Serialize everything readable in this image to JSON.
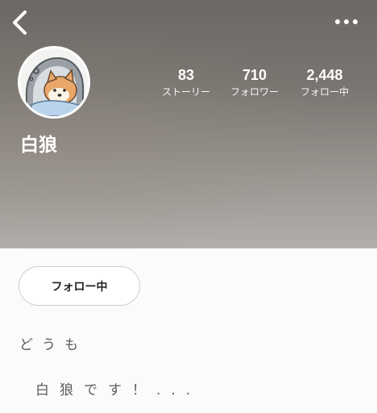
{
  "nav": {
    "back_icon": "chevron-left-icon",
    "more_icon": "more-horizontal-icon"
  },
  "profile": {
    "name": "白狼",
    "avatar_icon": "shiba-dog-avatar",
    "stats": [
      {
        "value": "83",
        "label": "ストーリー"
      },
      {
        "value": "710",
        "label": "フォロワー"
      },
      {
        "value": "2,448",
        "label": "フォロー中"
      }
    ],
    "follow_button_label": "フォロー中",
    "bio": {
      "line1": "どうも",
      "line2": "白狼です！..."
    }
  },
  "colors": {
    "header_top": "#6d6864",
    "header_bottom": "#b3aeaa",
    "page_bg": "#fbfbfb",
    "text_white": "#ffffff",
    "bio_text": "#5b5b5b"
  }
}
